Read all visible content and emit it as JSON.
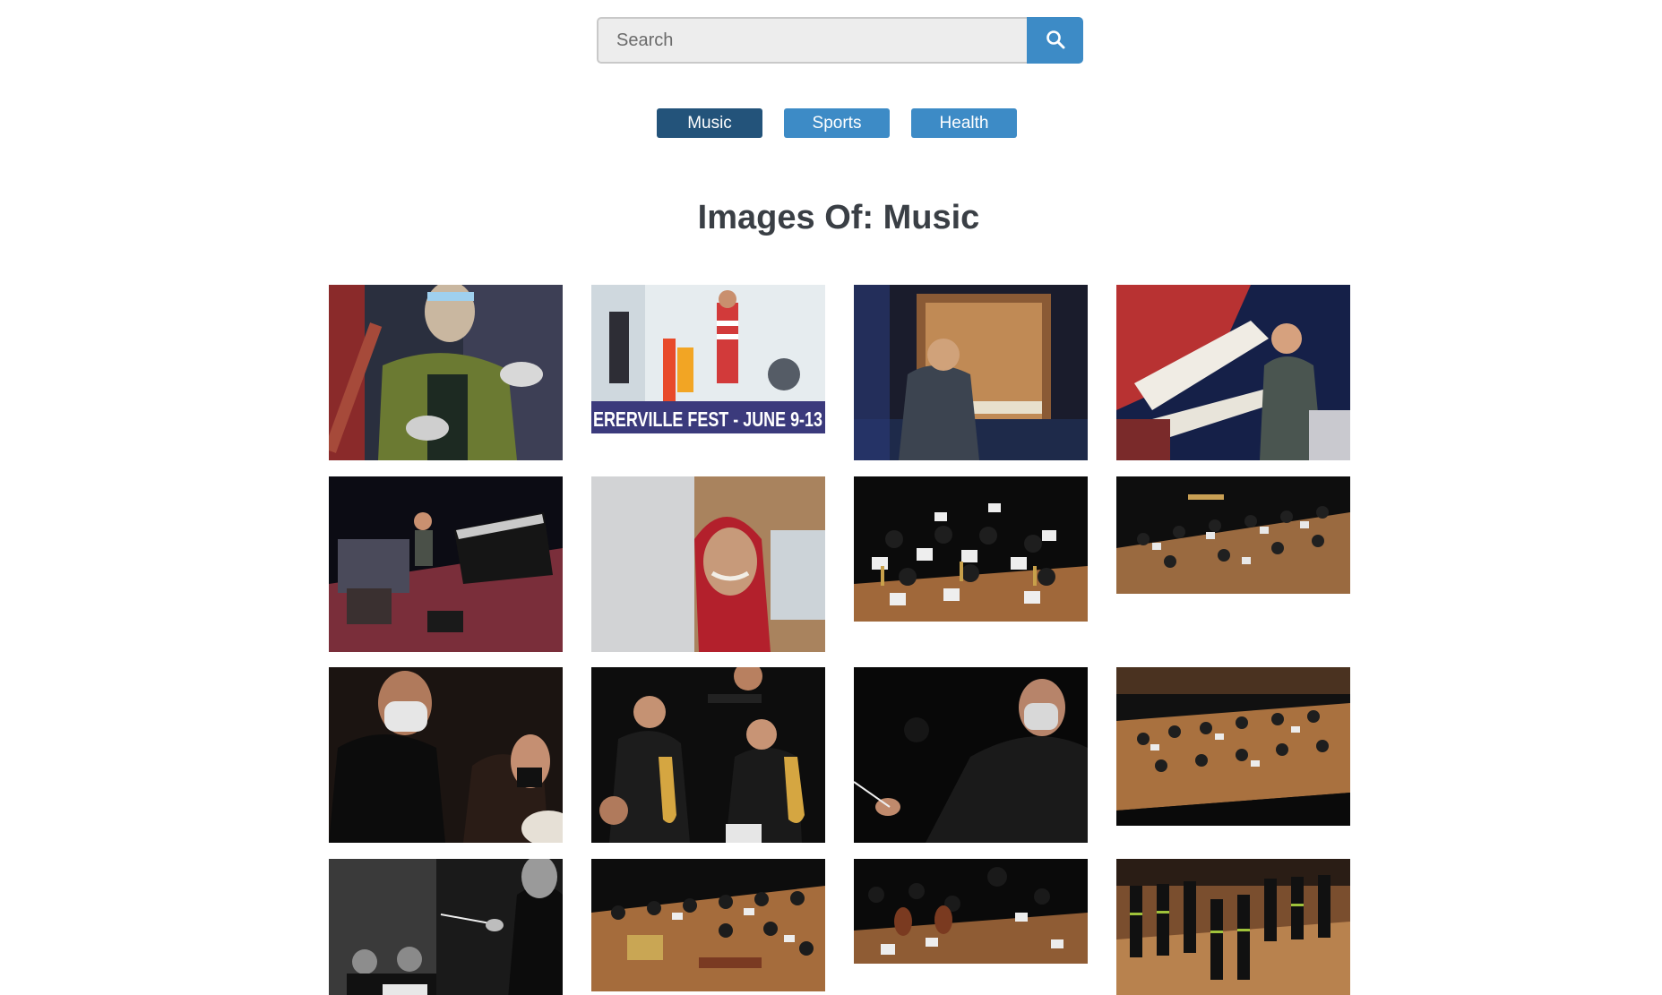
{
  "search": {
    "placeholder": "Search",
    "button_icon": "search-icon"
  },
  "categories": [
    {
      "label": "Music",
      "active": true
    },
    {
      "label": "Sports",
      "active": false
    },
    {
      "label": "Health",
      "active": false
    }
  ],
  "heading": "Images Of: Music",
  "gallery": {
    "images": [
      {
        "name": "masked-performer-photo"
      },
      {
        "name": "fest-band-stage-photo",
        "banner_text": "ERERVILLE FEST - JUNE 9-13"
      },
      {
        "name": "organist-photo"
      },
      {
        "name": "pianist-red-keyboard-photo"
      },
      {
        "name": "stage-pianist-photo"
      },
      {
        "name": "old-woman-red-hood-photo"
      },
      {
        "name": "orchestra-saxophones-photo"
      },
      {
        "name": "orchestra-stage-wide-photo"
      },
      {
        "name": "masked-conductor-closeup-photo"
      },
      {
        "name": "saxophone-section-photo"
      },
      {
        "name": "conductor-baton-photo"
      },
      {
        "name": "orchestra-hall-wide-photo"
      },
      {
        "name": "conductor-bw-photo"
      },
      {
        "name": "percussion-orchestra-photo"
      },
      {
        "name": "strings-orchestra-photo"
      },
      {
        "name": "choir-stage-photo"
      }
    ]
  },
  "colors": {
    "accent": "#3d8bc6",
    "active": "#23537a",
    "heading": "#3a3f45"
  }
}
